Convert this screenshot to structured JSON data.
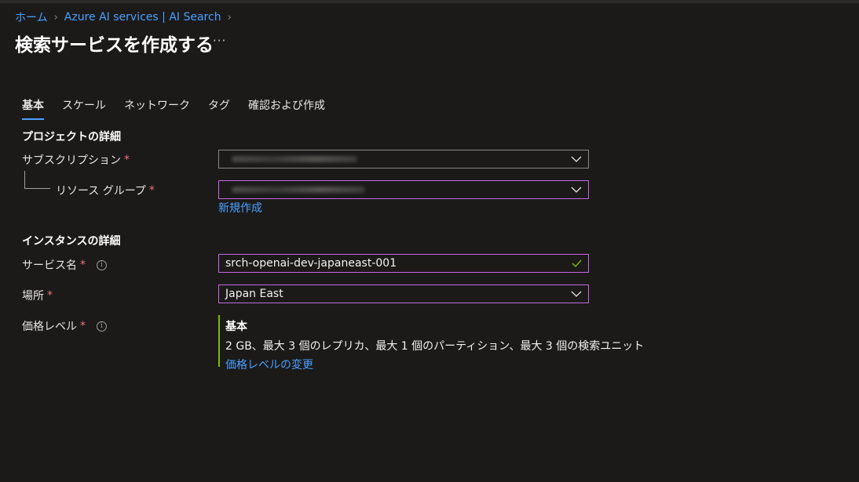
{
  "breadcrumb": {
    "items": [
      "ホーム",
      "Azure AI services | AI Search"
    ]
  },
  "header": {
    "title": "検索サービスを作成する",
    "more": "···"
  },
  "tabs": [
    {
      "label": "基本",
      "active": true
    },
    {
      "label": "スケール",
      "active": false
    },
    {
      "label": "ネットワーク",
      "active": false
    },
    {
      "label": "タグ",
      "active": false
    },
    {
      "label": "確認および作成",
      "active": false
    }
  ],
  "project": {
    "heading": "プロジェクトの詳細",
    "subscription_label": "サブスクリプション",
    "resource_group_label": "リソース グループ",
    "create_new_link": "新規作成"
  },
  "instance": {
    "heading": "インスタンスの詳細",
    "service_name_label": "サービス名",
    "service_name_value": "srch-openai-dev-japaneast-001",
    "location_label": "場所",
    "location_value": "Japan East",
    "pricing_label": "価格レベル",
    "pricing_tier_name": "基本",
    "pricing_tier_desc": "2 GB、最大 3 個のレプリカ、最大 1 個のパーティション、最大 3 個の検索ユニット",
    "pricing_change_link": "価格レベルの変更"
  },
  "required_mark": "*",
  "info_glyph": "i",
  "colors": {
    "background": "#1b1a19",
    "link": "#4aa0ff",
    "focus_border": "#c569e0",
    "required": "#f1707b",
    "valid_check": "#7fba00",
    "tier_accent": "#7fba00"
  }
}
